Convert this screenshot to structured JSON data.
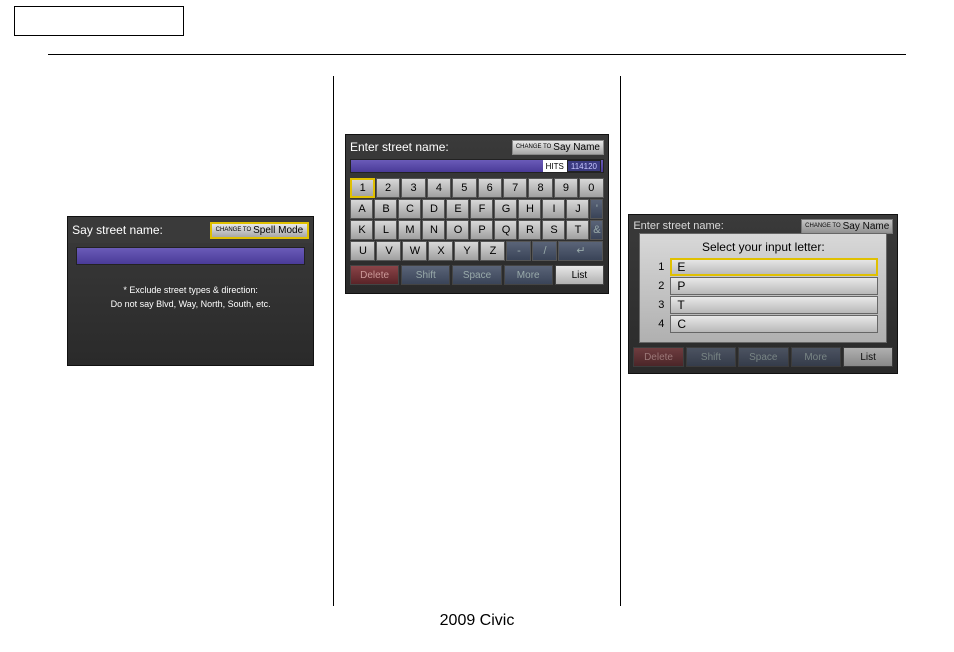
{
  "footer": "2009 Civic",
  "screen1": {
    "title": "Say street name:",
    "button_small": "CHANGE TO",
    "button": "Spell Mode",
    "note_line1": "* Exclude street types & direction:",
    "note_line2": "Do not say Blvd, Way, North, South, etc."
  },
  "screen2": {
    "title": "Enter street name:",
    "button_small": "CHANGE TO",
    "button": "Say Name",
    "hits_label": "HITS",
    "hits_value": "114120",
    "row1": [
      "1",
      "2",
      "3",
      "4",
      "5",
      "6",
      "7",
      "8",
      "9",
      "0"
    ],
    "row2": [
      "A",
      "B",
      "C",
      "D",
      "E",
      "F",
      "G",
      "H",
      "I",
      "J"
    ],
    "row2_dark": [
      "'"
    ],
    "row3": [
      "K",
      "L",
      "M",
      "N",
      "O",
      "P",
      "Q",
      "R",
      "S",
      "T"
    ],
    "row3_dark": [
      "&"
    ],
    "row4": [
      "U",
      "V",
      "W",
      "X",
      "Y",
      "Z"
    ],
    "row4_dark": [
      "-",
      "/",
      "↵"
    ],
    "bottom": {
      "delete": "Delete",
      "shift": "Shift",
      "space": "Space",
      "more": "More",
      "list": "List"
    }
  },
  "screen3": {
    "title": "Enter street name:",
    "button_small": "CHANGE TO",
    "button": "Say Name",
    "popup_title": "Select your input letter:",
    "options": [
      {
        "num": "1",
        "val": "E"
      },
      {
        "num": "2",
        "val": "P"
      },
      {
        "num": "3",
        "val": "T"
      },
      {
        "num": "4",
        "val": "C"
      }
    ],
    "bottom": {
      "delete": "Delete",
      "shift": "Shift",
      "space": "Space",
      "more": "More",
      "list": "List"
    }
  }
}
